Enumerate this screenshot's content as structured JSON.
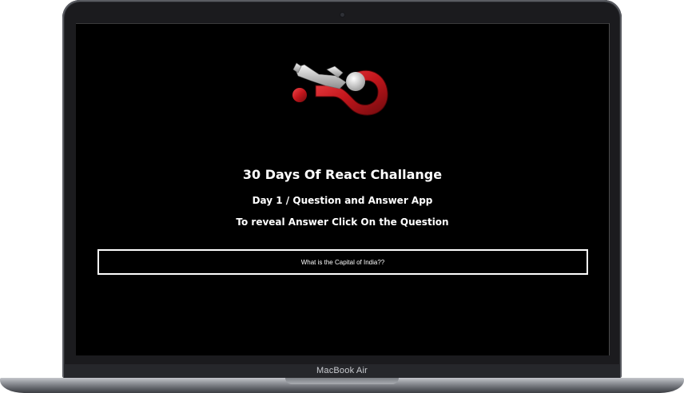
{
  "device": {
    "model_label": "MacBook Air"
  },
  "app": {
    "title": "30 Days Of React Challange",
    "subtitle": "Day 1 / Question and Answer App",
    "instruction": "To reveal Answer Click On the Question",
    "hero_icon": "question-mark-figure-icon",
    "questions": [
      {
        "text": "What is the Capital of India??"
      }
    ]
  },
  "colors": {
    "screen_background": "#000000",
    "text": "#ffffff",
    "question_mark_red": "#c3161c"
  }
}
